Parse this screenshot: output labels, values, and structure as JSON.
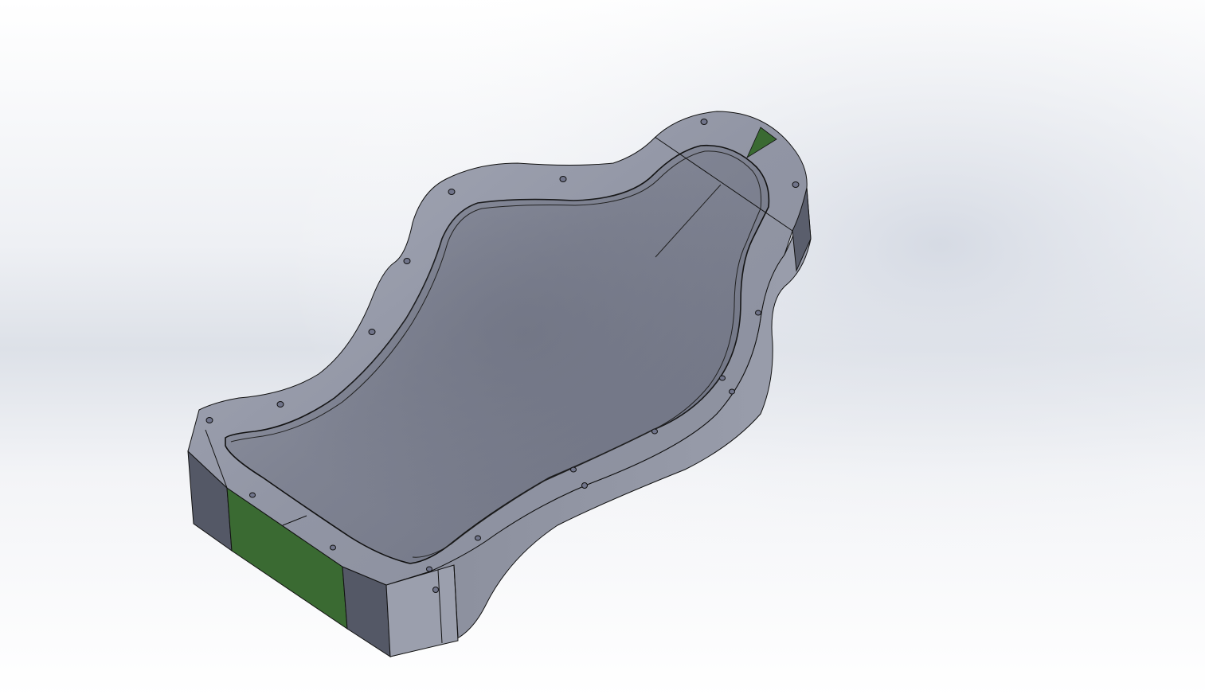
{
  "viewport": {
    "background_top": "#ffffff",
    "background_mid": "#dfe3ea",
    "background_bottom": "#ffffff"
  },
  "model": {
    "name": "seat-mold",
    "body_color": "#8c909e",
    "body_light": "#a4a8b6",
    "body_dark": "#5e6270",
    "cavity_color": "#7d8190",
    "selected_face_color": "#3a6a32",
    "edge_color": "#111111"
  }
}
